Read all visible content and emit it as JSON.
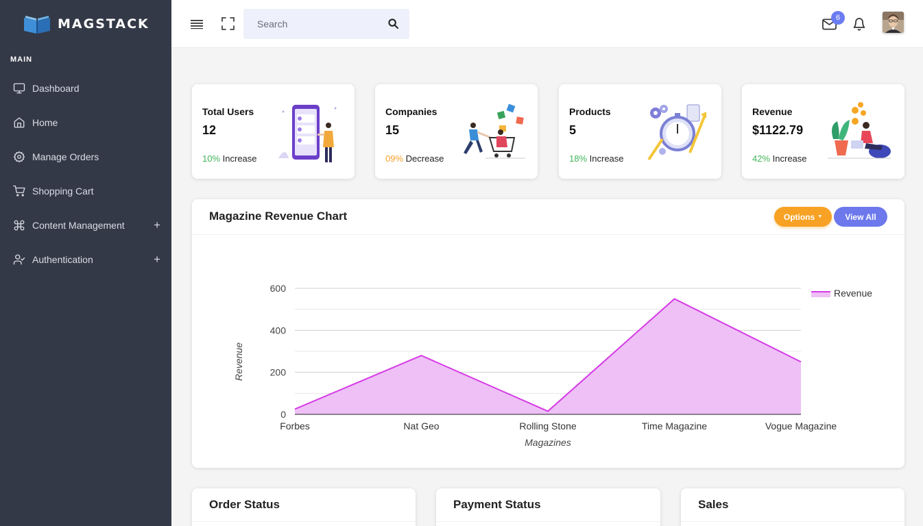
{
  "brand": {
    "name": "MAGSTACK"
  },
  "sidebar": {
    "section": "MAIN",
    "items": [
      {
        "label": "Dashboard",
        "icon": "monitor-icon"
      },
      {
        "label": "Home",
        "icon": "home-icon"
      },
      {
        "label": "Manage Orders",
        "icon": "gear-icon"
      },
      {
        "label": "Shopping Cart",
        "icon": "cart-icon"
      },
      {
        "label": "Content Management",
        "icon": "command-icon",
        "expand": "+"
      },
      {
        "label": "Authentication",
        "icon": "user-check-icon",
        "expand": "+"
      }
    ]
  },
  "header": {
    "search_placeholder": "Search",
    "notifications_count": "6"
  },
  "stats": [
    {
      "title": "Total Users",
      "value": "12",
      "change": "10%",
      "change_label": "Increase",
      "change_color": "#41b35a"
    },
    {
      "title": "Companies",
      "value": "15",
      "change": "09%",
      "change_label": "Decrease",
      "change_color": "#f7a02a"
    },
    {
      "title": "Products",
      "value": "5",
      "change": "18%",
      "change_label": "Increase",
      "change_color": "#41b35a"
    },
    {
      "title": "Revenue",
      "value": "$1122.79",
      "change": "42%",
      "change_label": "Increase",
      "change_color": "#41b35a"
    }
  ],
  "chart_card": {
    "title": "Magazine Revenue Chart",
    "options_label": "Options",
    "view_all_label": "View All"
  },
  "chart_data": {
    "type": "area",
    "categories": [
      "Forbes",
      "Nat Geo",
      "Rolling Stone",
      "Time Magazine",
      "Vogue Magazine"
    ],
    "series": [
      {
        "name": "Revenue",
        "values": [
          25,
          280,
          15,
          550,
          250
        ],
        "color": "#d63be6",
        "fill": "#eec0f6"
      }
    ],
    "xlabel": "Magazines",
    "ylabel": "Revenue",
    "ylim": [
      0,
      600
    ],
    "yticks": [
      0,
      200,
      400,
      600
    ],
    "grid": true,
    "legend": "top-right"
  },
  "bottom_cards": [
    {
      "title": "Order Status"
    },
    {
      "title": "Payment Status"
    },
    {
      "title": "Sales"
    }
  ]
}
